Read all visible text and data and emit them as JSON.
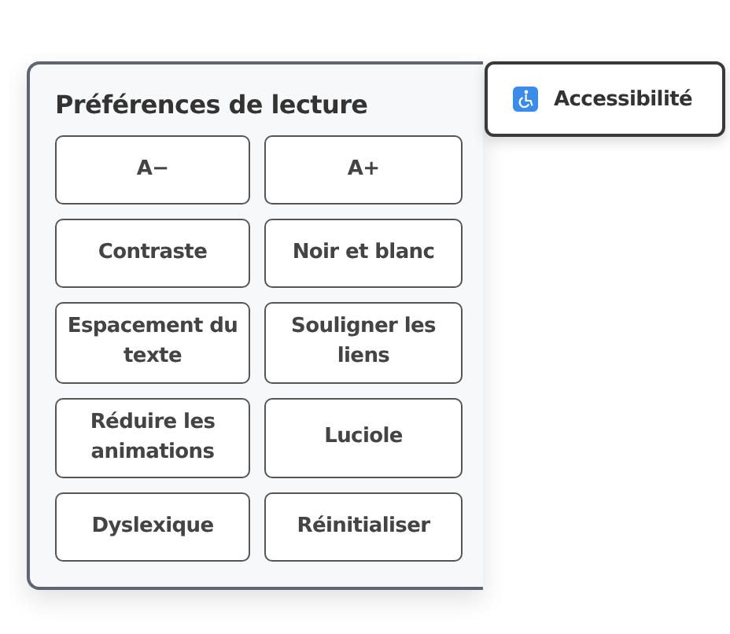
{
  "panel": {
    "title": "Préférences de lecture",
    "buttons": [
      {
        "label": "A−"
      },
      {
        "label": "A+"
      },
      {
        "label": "Contraste"
      },
      {
        "label": "Noir et blanc"
      },
      {
        "label": "Espacement du texte"
      },
      {
        "label": "Souligner les liens"
      },
      {
        "label": "Réduire les animations"
      },
      {
        "label": "Luciole"
      },
      {
        "label": "Dyslexique"
      },
      {
        "label": "Réinitialiser"
      }
    ]
  },
  "toggle": {
    "label": "Accessibilité"
  }
}
